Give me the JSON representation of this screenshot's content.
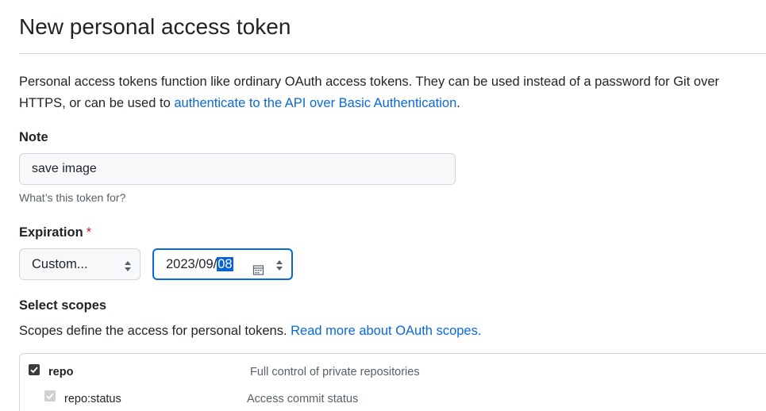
{
  "page": {
    "title": "New personal access token"
  },
  "intro": {
    "text": "Personal access tokens function like ordinary OAuth access tokens. They can be used instead of a password for Git over HTTPS, or can be used to ",
    "link": "authenticate to the API over Basic Authentication",
    "end": "."
  },
  "note": {
    "label": "Note",
    "value": "save image",
    "hint": "What’s this token for?"
  },
  "expiration": {
    "label": "Expiration",
    "required_mark": "*",
    "select_value": "Custom...",
    "date_prefix": "2023/09/",
    "date_selected": "08"
  },
  "scopes": {
    "label": "Select scopes",
    "description": "Scopes define the access for personal tokens. ",
    "link": "Read more about OAuth scopes.",
    "items": [
      {
        "name": "repo",
        "description": "Full control of private repositories",
        "checked": true,
        "disabled": false
      },
      {
        "name": "repo:status",
        "description": "Access commit status",
        "checked": true,
        "disabled": true
      }
    ]
  },
  "colors": {
    "link": "#0969da",
    "focus_border": "#0969da",
    "required": "#cf222e"
  }
}
